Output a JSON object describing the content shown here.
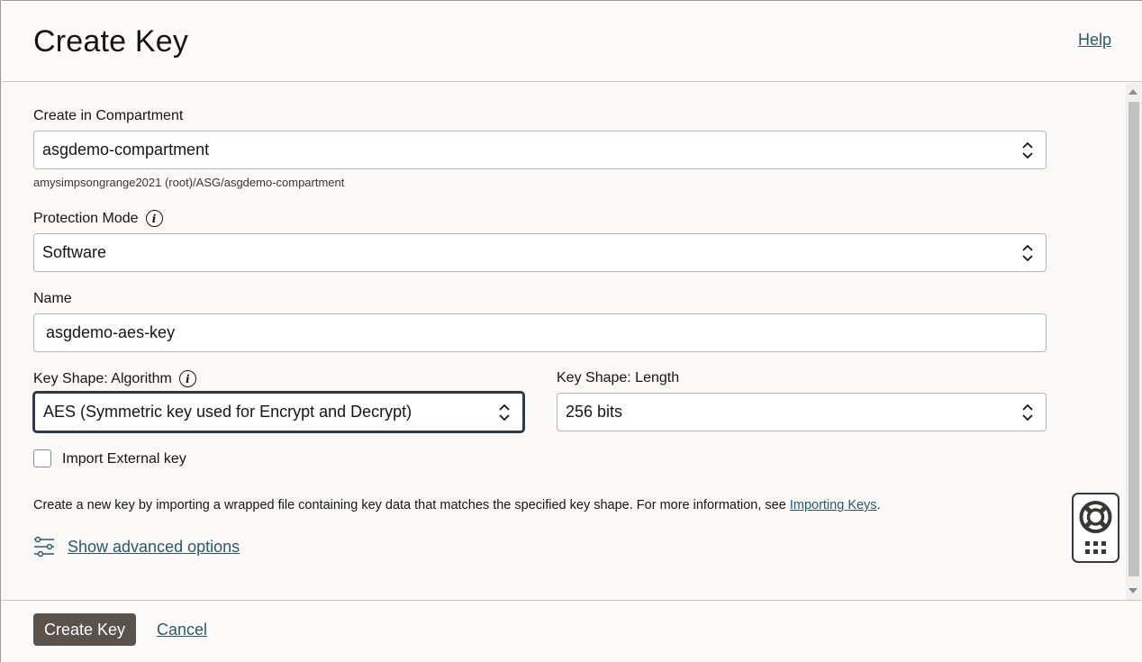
{
  "header": {
    "title": "Create Key",
    "help_label": "Help"
  },
  "form": {
    "compartment": {
      "label": "Create in Compartment",
      "value": "asgdemo-compartment",
      "path_hint": "amysimpsongrange2021 (root)/ASG/asgdemo-compartment"
    },
    "protection_mode": {
      "label": "Protection Mode",
      "value": "Software"
    },
    "name": {
      "label": "Name",
      "value": "asgdemo-aes-key"
    },
    "algorithm": {
      "label": "Key Shape: Algorithm",
      "value": "AES (Symmetric key used for Encrypt and Decrypt)"
    },
    "length": {
      "label": "Key Shape: Length",
      "value": "256 bits"
    },
    "import_external": {
      "label": "Import External key",
      "checked": false
    },
    "import_description": "Create a new key by importing a wrapped file containing key data that matches the specified key shape. For more information, see",
    "import_link": "Importing Keys",
    "import_suffix": ".",
    "advanced_label": "Show advanced options"
  },
  "footer": {
    "create_label": "Create Key",
    "cancel_label": "Cancel"
  },
  "icons": {
    "info": "info-icon",
    "sliders": "sliders-icon",
    "lifebuoy": "lifebuoy-icon",
    "apps": "apps-grid-icon",
    "chevron": "updown-chevron-icon"
  },
  "colors": {
    "link": "#2c5967",
    "primary_button": "#5a524d",
    "focus_ring": "#2c3b4a"
  }
}
